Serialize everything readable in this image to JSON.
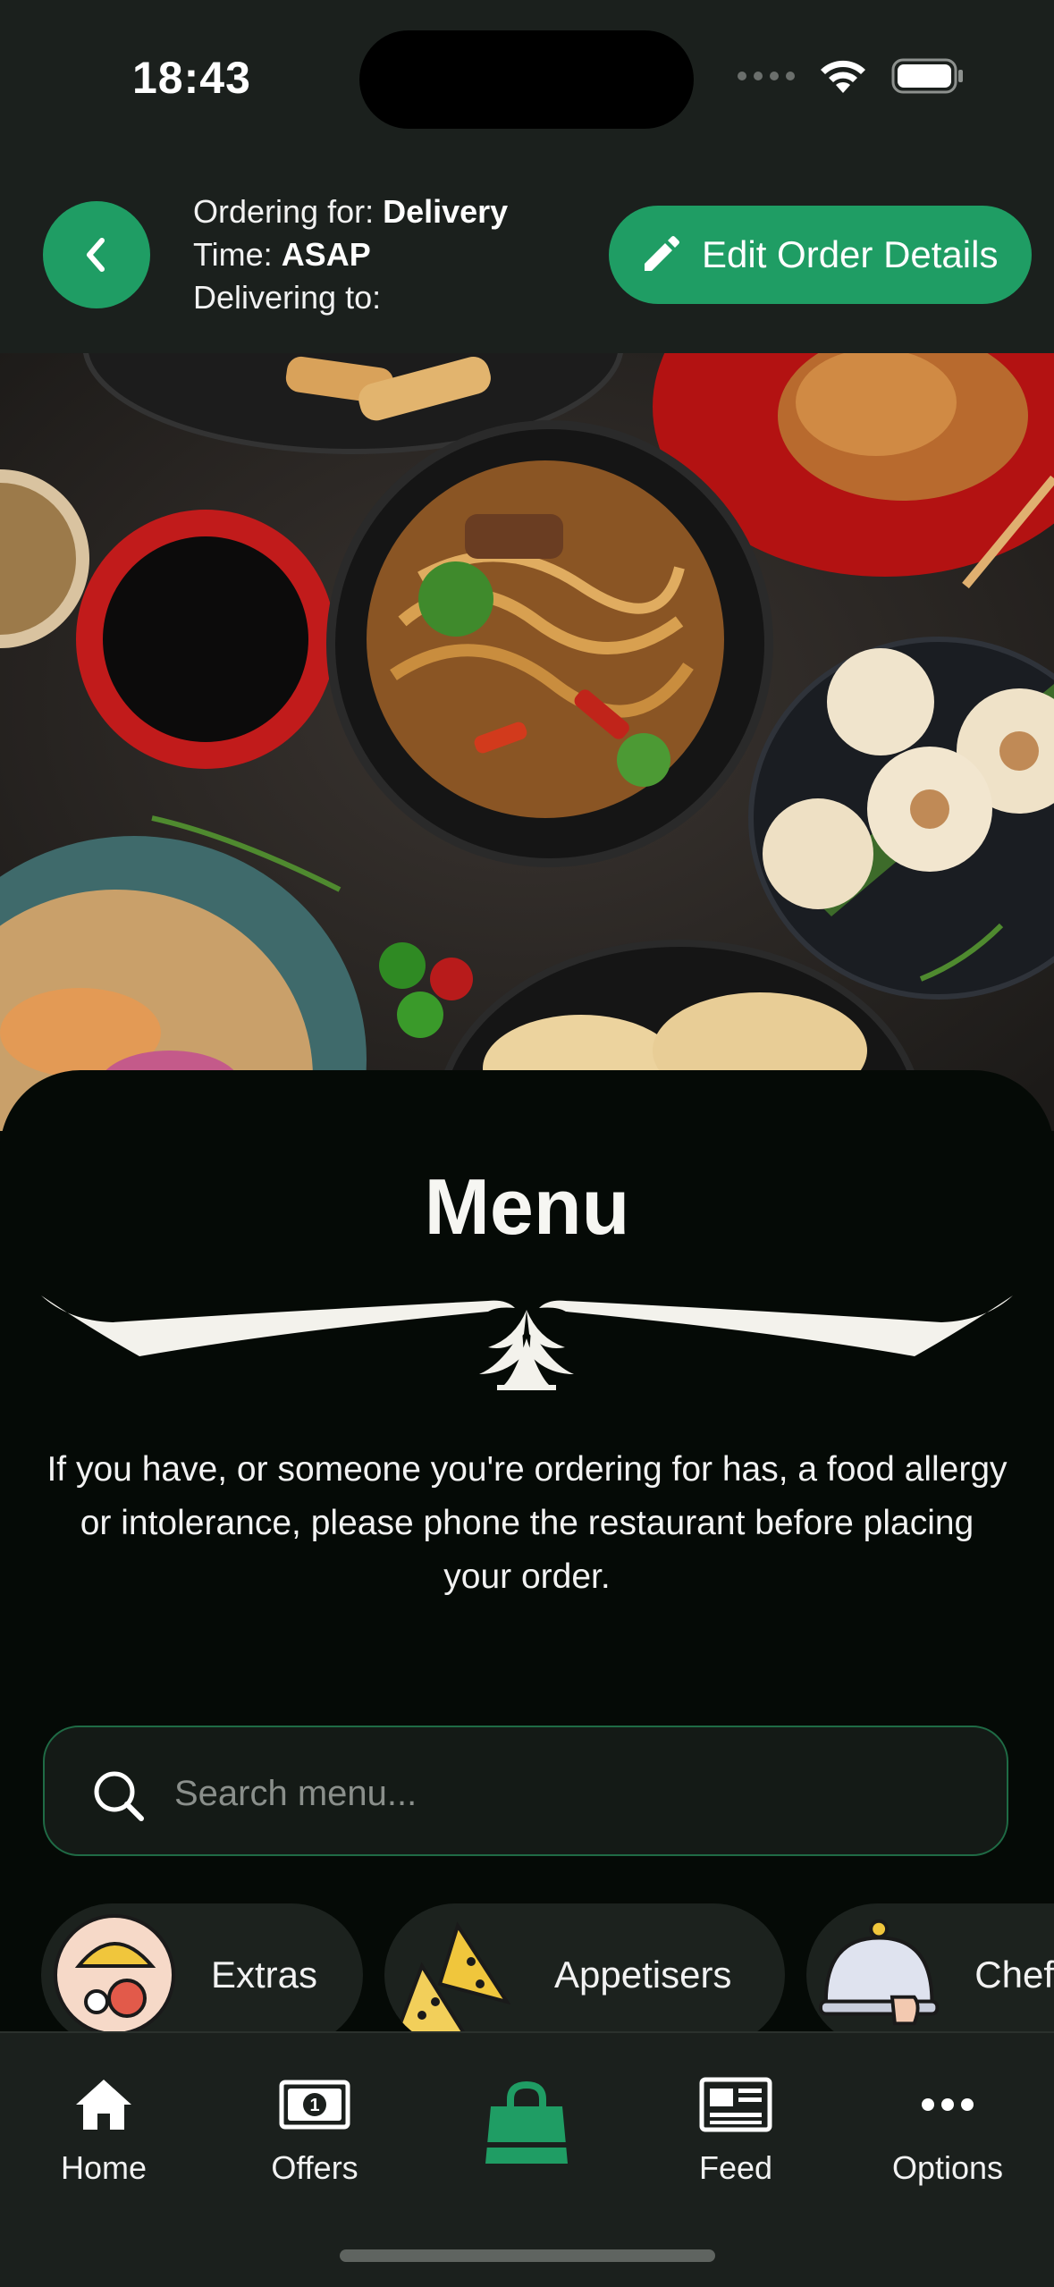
{
  "status_bar": {
    "time": "18:43"
  },
  "header": {
    "ordering_for_label": "Ordering for:",
    "ordering_for_value": "Delivery",
    "time_label": "Time:",
    "time_value": "ASAP",
    "delivering_to_label": "Delivering to:",
    "edit_button_label": "Edit Order Details"
  },
  "menu": {
    "title": "Menu",
    "allergy_notice": "If you have, or someone you're ordering for has, a food allergy or intolerance, please phone the restaurant before placing your order.",
    "search_placeholder": "Search menu..."
  },
  "categories": [
    {
      "label": "Extras",
      "icon": "extras-icon"
    },
    {
      "label": "Appetisers",
      "icon": "nachos-icon"
    },
    {
      "label": "Chef",
      "icon": "cloche-icon"
    }
  ],
  "tab_bar": {
    "items": [
      {
        "label": "Home",
        "icon": "home-icon"
      },
      {
        "label": "Offers",
        "icon": "banknote-icon"
      },
      {
        "label": "",
        "icon": "shopping-bag-icon"
      },
      {
        "label": "Feed",
        "icon": "newspaper-icon"
      },
      {
        "label": "Options",
        "icon": "more-icon"
      }
    ]
  },
  "colors": {
    "accent": "#1f9d64",
    "header_background": "#1b201d",
    "panel_background": "#050a06"
  }
}
